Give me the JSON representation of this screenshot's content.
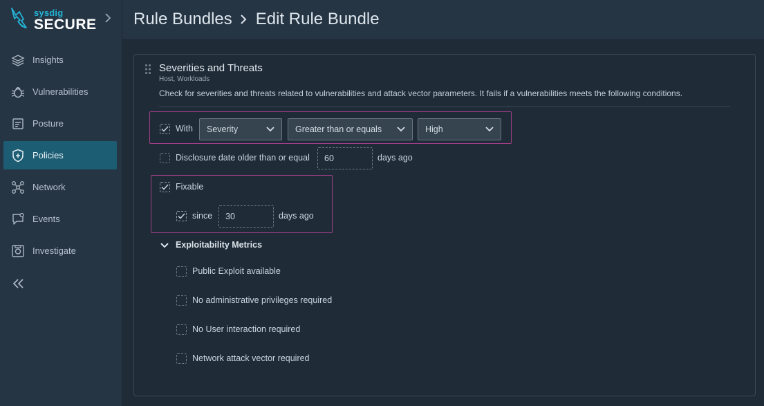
{
  "brand": {
    "top": "sysdig",
    "bottom": "SECURE"
  },
  "colors": {
    "accent": "#24b3d5",
    "active_nav": "#1d5d74",
    "highlight": "#a23f86"
  },
  "sidebar": {
    "items": [
      {
        "label": "Insights",
        "icon": "layers-icon"
      },
      {
        "label": "Vulnerabilities",
        "icon": "bug-icon"
      },
      {
        "label": "Posture",
        "icon": "clipboard-icon"
      },
      {
        "label": "Policies",
        "icon": "shield-icon",
        "active": true
      },
      {
        "label": "Network",
        "icon": "network-icon"
      },
      {
        "label": "Events",
        "icon": "chat-icon"
      },
      {
        "label": "Investigate",
        "icon": "camera-icon"
      }
    ],
    "collapse_icon": "double-chevron-left-icon"
  },
  "header": {
    "crumb_parent": "Rule Bundles",
    "crumb_current": "Edit Rule Bundle"
  },
  "card": {
    "title": "Severities and Threats",
    "subtitle": "Host, Workloads",
    "description": "Check for severities and threats related to vulnerabilities and attack vector parameters. It fails if a vulnerabilities meets the following conditions."
  },
  "conditions": {
    "with": {
      "label": "With",
      "checked": true,
      "field": "Severity",
      "operator": "Greater than or equals",
      "value": "High"
    },
    "disclosure": {
      "label": "Disclosure date older than or equal",
      "checked": false,
      "value": "60",
      "suffix": "days ago"
    },
    "fixable": {
      "label": "Fixable",
      "checked": true,
      "since_label": "since",
      "since_checked": true,
      "since_value": "30",
      "suffix": "days ago"
    },
    "exploitability": {
      "title": "Exploitability Metrics",
      "items": [
        {
          "label": "Public Exploit available",
          "checked": false
        },
        {
          "label": "No administrative privileges required",
          "checked": false
        },
        {
          "label": "No User interaction required",
          "checked": false
        },
        {
          "label": "Network attack vector required",
          "checked": false
        }
      ]
    }
  }
}
